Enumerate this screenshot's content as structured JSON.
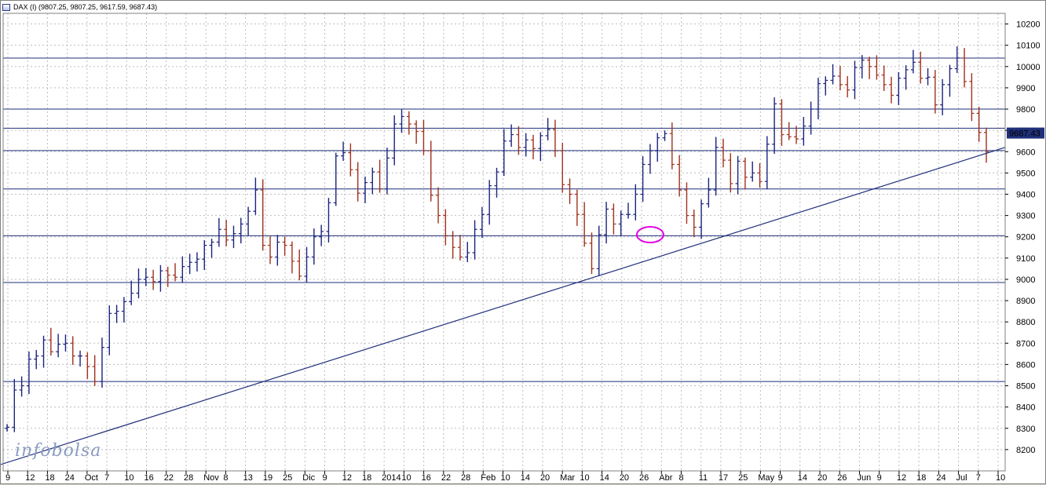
{
  "window": {
    "title": "DAX (I) (9807.25, 9807.25, 9617.59, 9687.43)"
  },
  "watermark": "infobolsa",
  "last_price_label": "9687.43",
  "chart_data": {
    "type": "ohlc",
    "y_ticks": [
      "10200",
      "10100",
      "10000",
      "9900",
      "9800",
      "9700",
      "9600",
      "9500",
      "9400",
      "9300",
      "9200",
      "9100",
      "9000",
      "8900",
      "8800",
      "8700",
      "8600",
      "8500",
      "8400",
      "8300",
      "8200"
    ],
    "ylim": [
      8100,
      10250
    ],
    "x_labels": [
      "9",
      "12",
      "18",
      "24",
      "Oct",
      "7",
      "10",
      "16",
      "22",
      "28",
      "Nov",
      "8",
      "13",
      "19",
      "25",
      "Dic",
      "9",
      "12",
      "18",
      "2014",
      "10",
      "16",
      "22",
      "28",
      "Feb",
      "10",
      "14",
      "20",
      "Mar",
      "10",
      "14",
      "20",
      "26",
      "Abr",
      "8",
      "11",
      "17",
      "25",
      "May",
      "9",
      "14",
      "20",
      "26",
      "Jun",
      "9",
      "12",
      "18",
      "24",
      "Jul",
      "7",
      "10"
    ],
    "grid": true,
    "up_color": "#1a237e",
    "down_color": "#a0301c",
    "line_color": "#1f2f7a",
    "highlight_color": "#e400e4",
    "horizontal_levels": [
      10040,
      9800,
      9710,
      9605,
      9425,
      9205,
      8985,
      8520
    ],
    "trendline": {
      "start": [
        0,
        8130
      ],
      "end": [
        255,
        9620
      ]
    },
    "resistance_line": {
      "start": [
        247,
        10075
      ],
      "end": [
        252,
        9820
      ]
    },
    "ellipses": [
      {
        "x": 88,
        "y": 9210
      },
      {
        "x": 213,
        "y": 9810
      }
    ],
    "price_axis_label_value": 9687.43,
    "closes": [
      8305,
      8480,
      8500,
      8625,
      8640,
      8715,
      8660,
      8695,
      8700,
      8640,
      8640,
      8590,
      8520,
      8680,
      8840,
      8850,
      8895,
      8935,
      9000,
      9010,
      8990,
      9040,
      9020,
      9010,
      9060,
      9080,
      9095,
      9160,
      9175,
      9235,
      9185,
      9215,
      9260,
      9320,
      9420,
      9160,
      9105,
      9175,
      9160,
      9085,
      9015,
      9105,
      9200,
      9225,
      9360,
      9580,
      9595,
      9515,
      9405,
      9455,
      9505,
      9425,
      9570,
      9730,
      9765,
      9730,
      9695,
      9605,
      9395,
      9300,
      9205,
      9150,
      9105,
      9125,
      9235,
      9305,
      9440,
      9505,
      9650,
      9680,
      9620,
      9655,
      9615,
      9675,
      9705,
      9605,
      9445,
      9400,
      9305,
      9170,
      9050,
      9210,
      9330,
      9260,
      9305,
      9305,
      9400,
      9540,
      9605,
      9665,
      9685,
      9540,
      9420,
      9300,
      9245,
      9355,
      9420,
      9620,
      9560,
      9450,
      9555,
      9480,
      9500,
      9460,
      9635,
      9825,
      9680,
      9670,
      9660,
      9720,
      9800,
      9920,
      9935,
      9955,
      9915,
      9890,
      9995,
      10030,
      10000,
      9960,
      9915,
      9865,
      9945,
      9985,
      10020,
      9945,
      9950,
      9820,
      9915,
      9990,
      10040,
      9930,
      9780,
      9690,
      9600
    ]
  }
}
